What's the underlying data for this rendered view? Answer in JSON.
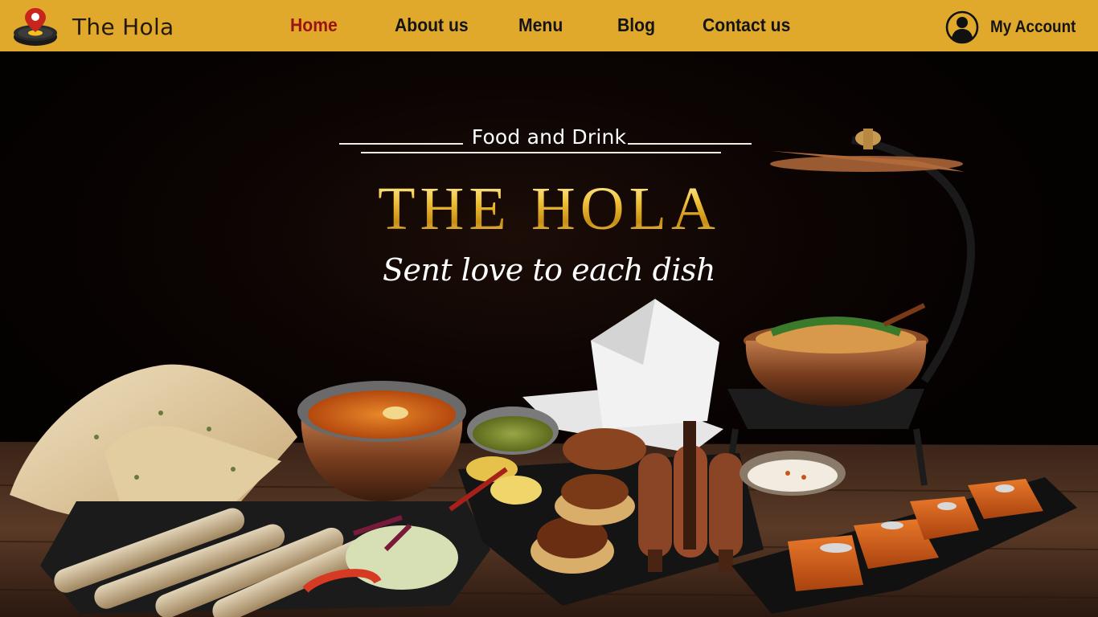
{
  "brand": {
    "name": "The Hola",
    "logo_icon": "dish-pin-logo-icon"
  },
  "nav": {
    "items": [
      {
        "label": "Home",
        "active": true
      },
      {
        "label": "About us",
        "active": false
      },
      {
        "label": "Menu",
        "active": false
      },
      {
        "label": "Blog",
        "active": false
      },
      {
        "label": "Contact us",
        "active": false
      }
    ]
  },
  "account": {
    "label": "My Account",
    "icon": "user-circle-icon"
  },
  "hero": {
    "tagline": "Food and Drink",
    "title": "THE HOLA",
    "subtitle": "Sent love to each dish",
    "image_description_icon": "food-spread-image"
  },
  "colors": {
    "navbar": "#e0a92c",
    "active_link": "#9a1410",
    "title_gold": "#e6b429",
    "hero_background": "#050202"
  }
}
